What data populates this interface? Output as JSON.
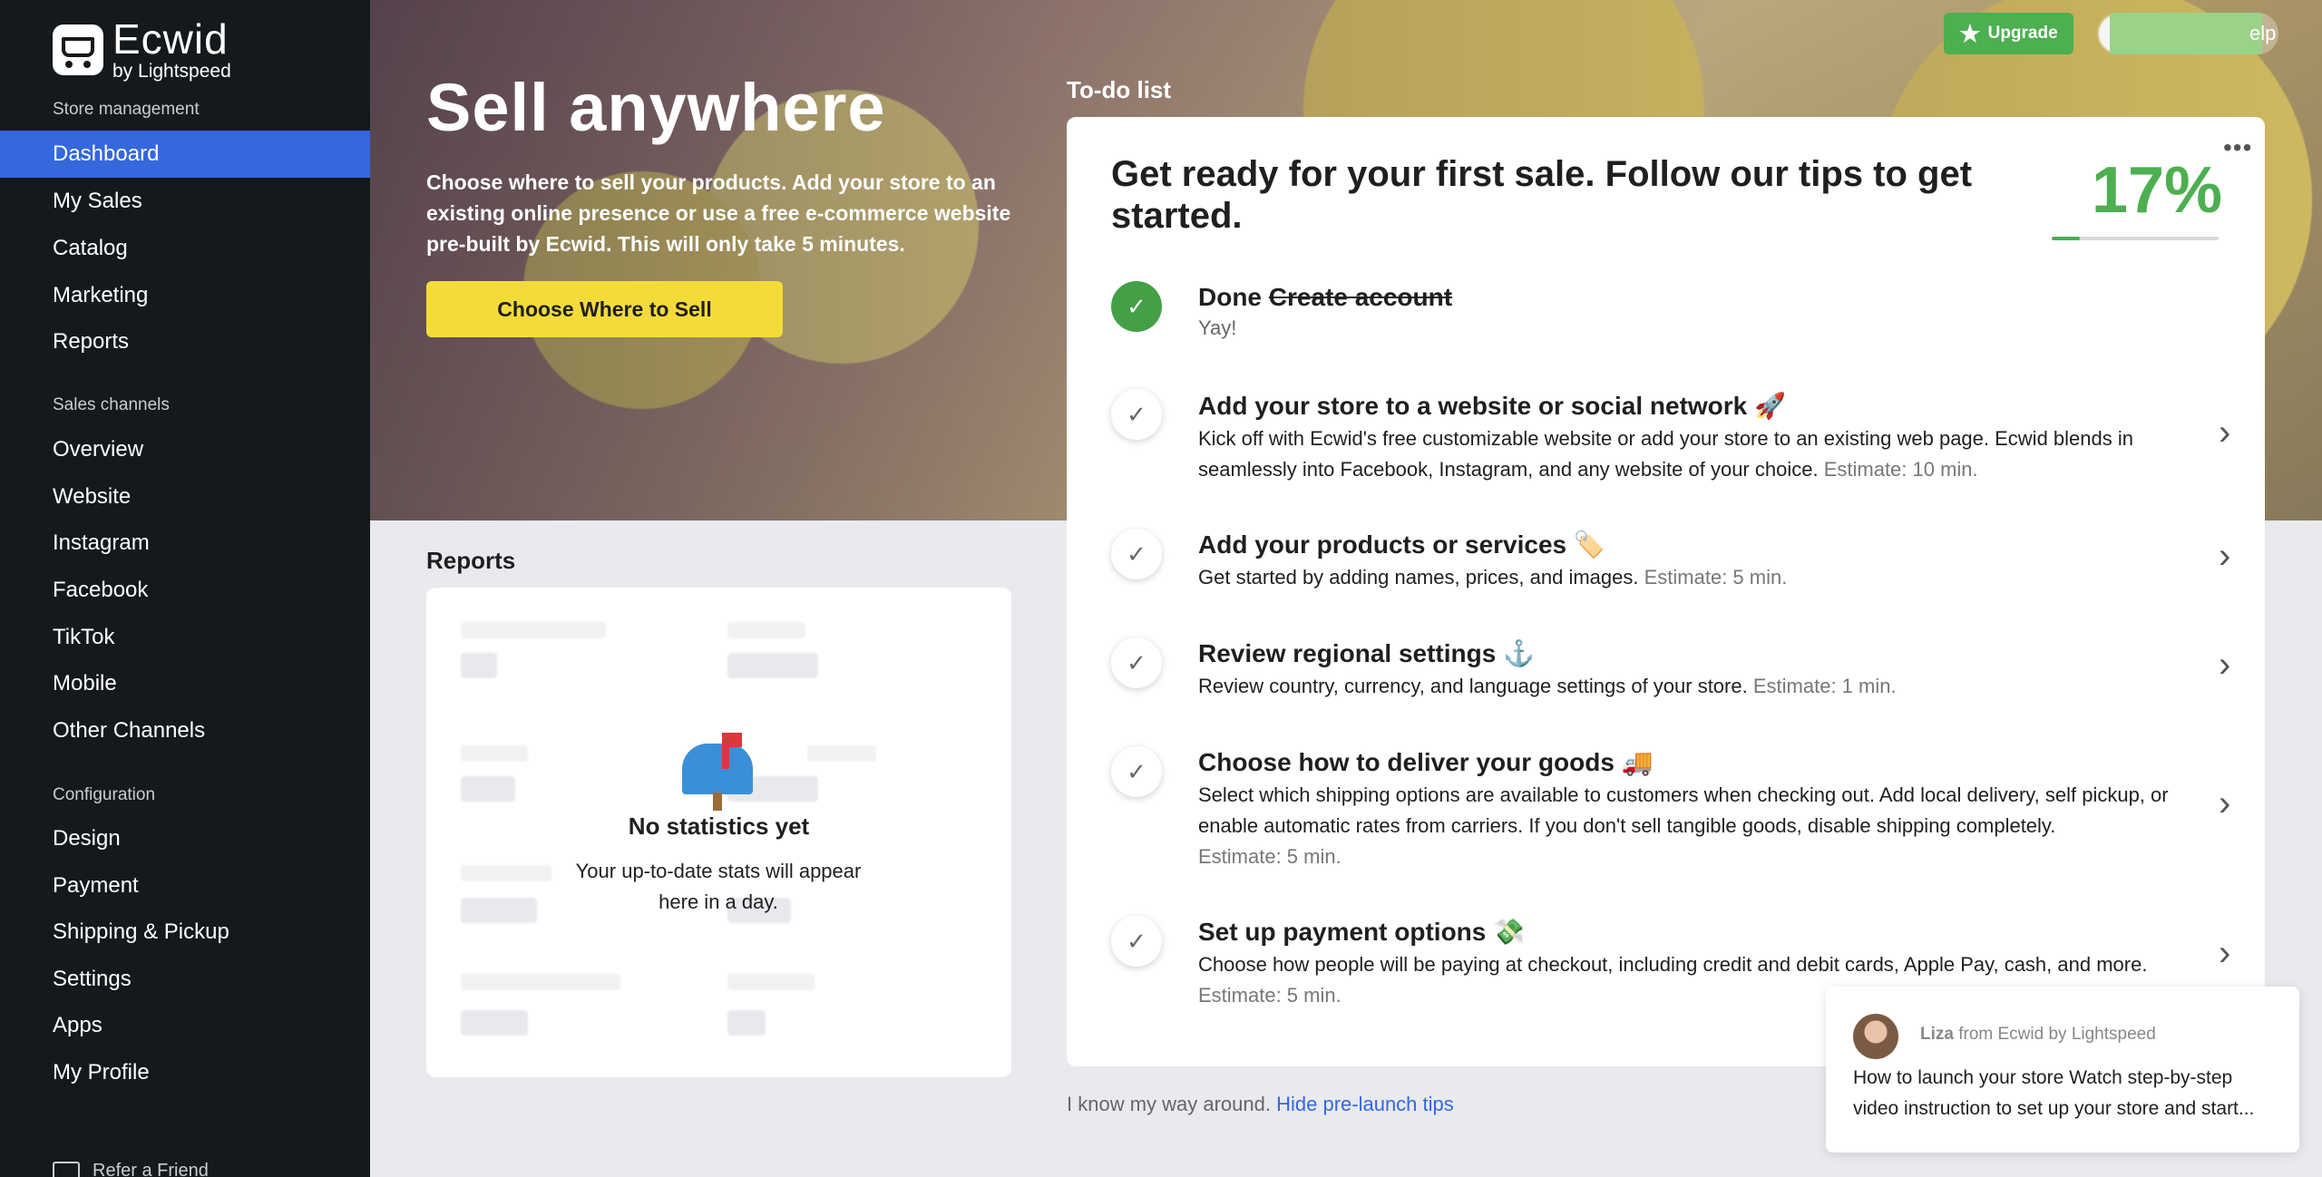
{
  "sidebar": {
    "logo_brand": "Ecwid",
    "logo_by": "by Lightspeed",
    "sections": {
      "store_management": "Store management",
      "sales_channels": "Sales channels",
      "configuration": "Configuration"
    },
    "store_items": [
      "Dashboard",
      "My Sales",
      "Catalog",
      "Marketing",
      "Reports"
    ],
    "channel_items": [
      "Overview",
      "Website",
      "Instagram",
      "Facebook",
      "TikTok",
      "Mobile",
      "Other Channels"
    ],
    "config_items": [
      "Design",
      "Payment",
      "Shipping & Pickup",
      "Settings",
      "Apps",
      "My Profile"
    ],
    "active_item": "Dashboard",
    "bottom_item": "Refer a Friend"
  },
  "header": {
    "upgrade_label": "Upgrade",
    "help_label": "elp"
  },
  "hero": {
    "title": "Sell anywhere",
    "description": "Choose where to sell your products. Add your store to an existing online presence or use a free e-commerce website pre-built by Ecwid. This will only take 5 minutes.",
    "button_label": "Choose Where to Sell"
  },
  "reports": {
    "title": "Reports",
    "empty_title": "No statistics yet",
    "empty_subtitle": "Your up-to-date stats will appear here in a day."
  },
  "todo": {
    "label": "To-do list",
    "heading": "Get ready for your first sale. Follow our tips to get started.",
    "progress_percent": "17%",
    "progress_value": 0.17,
    "tasks": [
      {
        "status": "Done",
        "title": "Create account",
        "desc": "Yay!",
        "estimate": ""
      },
      {
        "title": "Add your store to a website or social network 🚀",
        "desc": "Kick off with Ecwid's free customizable website or add your store to an existing web page. Ecwid blends in seamlessly into Facebook, Instagram, and any website of your choice.",
        "estimate": "Estimate: 10 min."
      },
      {
        "title": "Add your products or services 🏷️",
        "desc": "Get started by adding names, prices, and images.",
        "estimate": "Estimate: 5 min."
      },
      {
        "title": "Review regional settings ⚓",
        "desc": "Review country, currency, and language settings of your store.",
        "estimate": "Estimate: 1 min."
      },
      {
        "title": "Choose how to deliver your goods 🚚",
        "desc": "Select which shipping options are available to customers when checking out. Add local delivery, self pickup, or enable automatic rates from carriers. If you don't sell tangible goods, disable shipping completely.",
        "estimate": "Estimate: 5 min."
      },
      {
        "title": "Set up payment options 💸",
        "desc": "Choose how people will be paying at checkout, including credit and debit cards, Apple Pay, cash, and more.",
        "estimate": "Estimate: 5 min."
      }
    ],
    "footer_text": "I know my way around.",
    "footer_link": "Hide pre-launch tips"
  },
  "chat": {
    "sender_name": "Liza",
    "sender_from": "from Ecwid by Lightspeed",
    "message": "How to launch your store Watch step-by-step video instruction to set up your store and start..."
  },
  "colors": {
    "sidebar_bg": "#16191c",
    "active_nav": "#3567dd",
    "accent_yellow": "#f3dc3a",
    "upgrade_green": "#4caf50",
    "progress_green": "#4caf50"
  }
}
